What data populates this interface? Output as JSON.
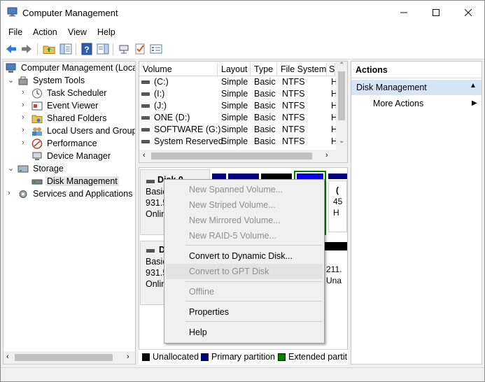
{
  "window": {
    "title": "Computer Management"
  },
  "menu": [
    "File",
    "Action",
    "View",
    "Help"
  ],
  "tree": {
    "root": "Computer Management (Local",
    "system_tools": "System Tools",
    "task_scheduler": "Task Scheduler",
    "event_viewer": "Event Viewer",
    "shared_folders": "Shared Folders",
    "local_users": "Local Users and Groups",
    "performance": "Performance",
    "device_manager": "Device Manager",
    "storage": "Storage",
    "disk_management": "Disk Management",
    "services": "Services and Applications"
  },
  "volume_list": {
    "columns": [
      "Volume",
      "Layout",
      "Type",
      "File System",
      "S"
    ],
    "rows": [
      {
        "volume": "(C:)",
        "layout": "Simple",
        "type": "Basic",
        "fs": "NTFS",
        "status": "H"
      },
      {
        "volume": "(I:)",
        "layout": "Simple",
        "type": "Basic",
        "fs": "NTFS",
        "status": "H"
      },
      {
        "volume": "(J:)",
        "layout": "Simple",
        "type": "Basic",
        "fs": "NTFS",
        "status": "H"
      },
      {
        "volume": "ONE (D:)",
        "layout": "Simple",
        "type": "Basic",
        "fs": "NTFS",
        "status": "H"
      },
      {
        "volume": "SOFTWARE (G:)",
        "layout": "Simple",
        "type": "Basic",
        "fs": "NTFS",
        "status": "H"
      },
      {
        "volume": "System Reserved",
        "layout": "Simple",
        "type": "Basic",
        "fs": "NTFS",
        "status": "H"
      }
    ]
  },
  "disk0": {
    "name": "Disk 0",
    "type": "Basic",
    "size": "931.5",
    "status": "Onlin",
    "right_col": [
      "(",
      "45",
      "H"
    ]
  },
  "disk1": {
    "name": "D",
    "type": "Basic",
    "size": "931.5",
    "status": "Onlin",
    "right_col": [
      "211.",
      "Una"
    ]
  },
  "legend": [
    {
      "label": "Unallocated",
      "color": "#000000"
    },
    {
      "label": "Primary partition",
      "color": "#000080"
    },
    {
      "label": "Extended partiti",
      "color": "#008000"
    }
  ],
  "context_menu": {
    "new_spanned": "New Spanned Volume...",
    "new_striped": "New Striped Volume...",
    "new_mirrored": "New Mirrored Volume...",
    "new_raid5": "New RAID-5 Volume...",
    "convert_dynamic": "Convert to Dynamic Disk...",
    "convert_gpt": "Convert to GPT Disk",
    "offline": "Offline",
    "properties": "Properties",
    "help": "Help"
  },
  "actions": {
    "header": "Actions",
    "section": "Disk Management",
    "more": "More Actions"
  },
  "colors": {
    "accent_selected": "#d6e5f5",
    "primary_partition": "#000080",
    "extended_partition": "#008000",
    "partition_blue": "#0000ff"
  }
}
